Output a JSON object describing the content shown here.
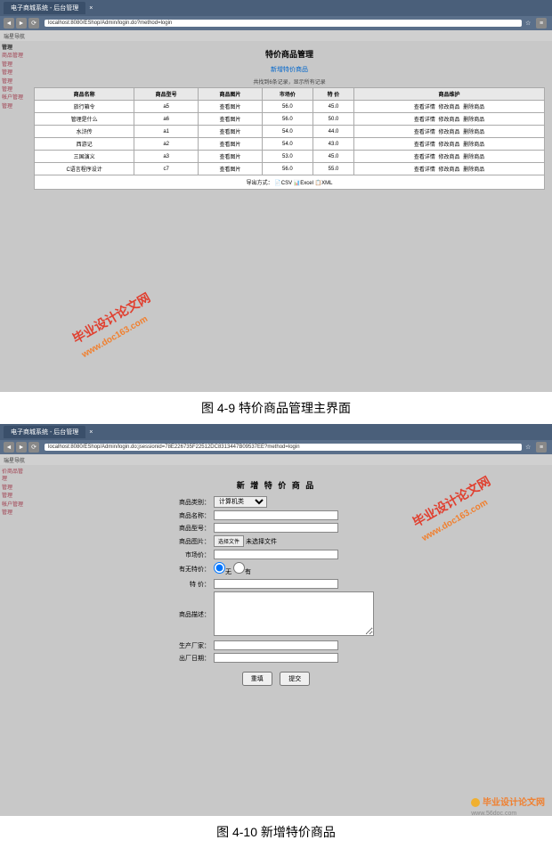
{
  "screenshot1": {
    "browser_tab": "电子商城系统 - 后台管理",
    "url": "localhost:8080/EShop/Admin/login.do?method=login",
    "bookmark": "瑞星导航",
    "sidebar_header": "管理",
    "sidebar_items": [
      "商品管理",
      "管理",
      "管理",
      "管理",
      "管理",
      "帐户管理",
      "管理"
    ],
    "title": "特价商品管理",
    "add_link": "新增特价商品",
    "summary": "共找到6条记录，显示所有记录",
    "table": {
      "headers": [
        "商品名称",
        "商品型号",
        "商品图片",
        "市场价",
        "特 价",
        "商品维护"
      ],
      "rows": [
        {
          "name": "旅行箱令",
          "model": "a5",
          "img": "查看图片",
          "market": "56.0",
          "special": "45.0"
        },
        {
          "name": "管理是什么",
          "model": "a6",
          "img": "查看图片",
          "market": "56.0",
          "special": "50.0"
        },
        {
          "name": "水浒传",
          "model": "a1",
          "img": "查看图片",
          "market": "54.0",
          "special": "44.0"
        },
        {
          "name": "西游记",
          "model": "a2",
          "img": "查看图片",
          "market": "54.0",
          "special": "43.0"
        },
        {
          "name": "三国演义",
          "model": "a3",
          "img": "查看图片",
          "market": "53.0",
          "special": "45.0"
        },
        {
          "name": "C语言程序设计",
          "model": "c7",
          "img": "查看图片",
          "market": "56.0",
          "special": "55.0"
        }
      ],
      "op_view": "查看详情",
      "op_edit": "修改商品",
      "op_del": "删除商品"
    },
    "export_label": "导出方式：",
    "export_csv": "CSV",
    "export_excel": "Excel",
    "export_xml": "XML",
    "caption": "图 4-9 特价商品管理主界面"
  },
  "screenshot2": {
    "browser_tab": "电子商城系统 - 后台管理",
    "url": "localhost:8080/EShop/Admin/login.do;jsessionid=78E226735F22512DC8313447B09537EE?method=login",
    "bookmark": "瑞星导航",
    "sidebar_items": [
      "价商品管理",
      "管理",
      "管理",
      "帐户管理",
      "管理"
    ],
    "form_title": "新 增 特 价 商 品",
    "fields": {
      "category_label": "商品类别：",
      "category_value": "计算机类",
      "name_label": "商品名称：",
      "model_label": "商品型号：",
      "image_label": "商品图片：",
      "file_btn": "选择文件",
      "file_none": "未选择文件",
      "market_label": "市场价：",
      "has_special_label": "有无特价：",
      "radio_no": "无",
      "radio_yes": "有",
      "special_label": "特 价：",
      "desc_label": "商品描述：",
      "maker_label": "生产厂家：",
      "date_label": "出厂日期："
    },
    "btn_reset": "重填",
    "btn_submit": "提交",
    "caption": "图 4-10 新增特价商品"
  },
  "watermark_main": "毕业设计论文网",
  "watermark_url": "www.doc163.com",
  "footer_wm": "毕业设计论文网",
  "footer_url": "www.56doc.com"
}
